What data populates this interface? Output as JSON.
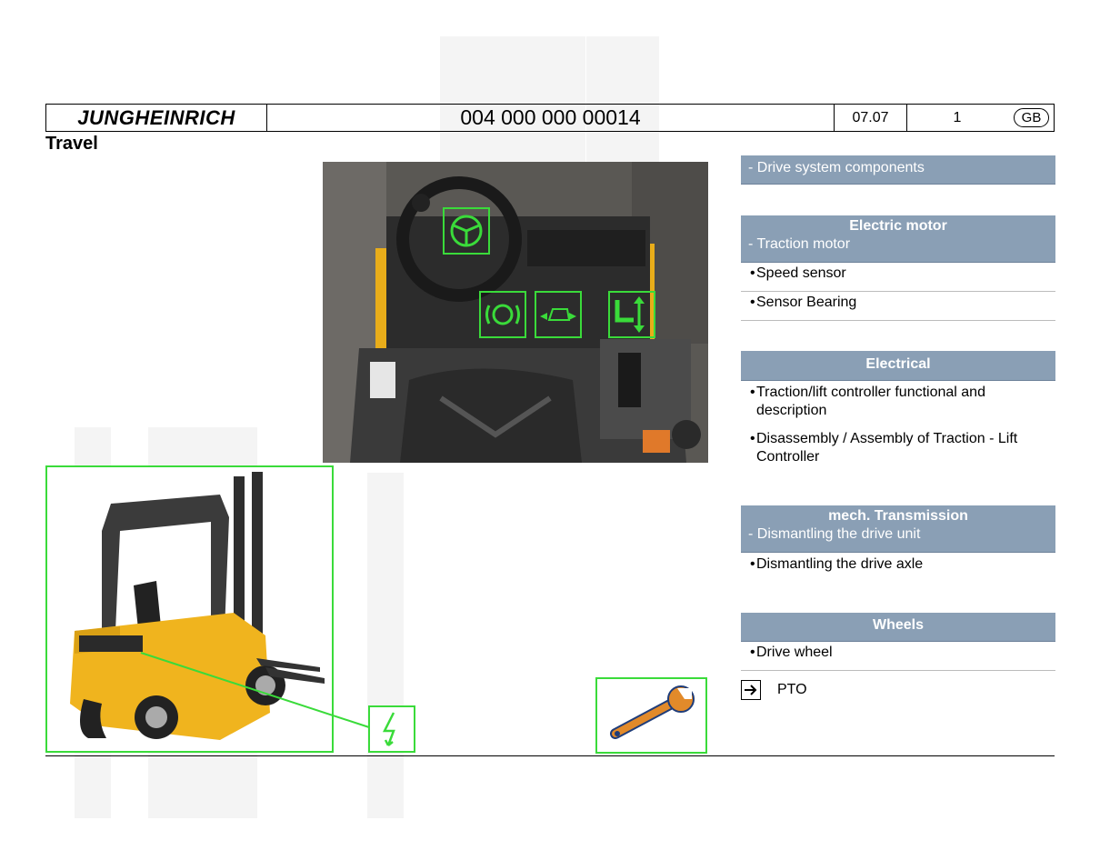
{
  "header": {
    "logo": "JUNGHEINRICH",
    "doc_number": "004 000 000 00014",
    "version": "07.07",
    "page": "1",
    "country": "GB"
  },
  "title": "Travel",
  "sections": [
    {
      "subtitle": "- Drive system components"
    },
    {
      "heading": "Electric motor",
      "subtitle": "- Traction motor",
      "items": [
        "Speed sensor",
        "Sensor Bearing"
      ]
    },
    {
      "heading": "Electrical",
      "items": [
        "Traction/lift controller functional and description",
        "Disassembly / Assembly of Traction - Lift Controller"
      ]
    },
    {
      "heading": "mech. Transmission",
      "subtitle": "- Dismantling the drive unit",
      "items": [
        "Dismantling the drive axle"
      ]
    },
    {
      "heading": "Wheels",
      "items": [
        "Drive wheel"
      ]
    }
  ],
  "pto_label": "PTO",
  "icons": {
    "steering": "steering-wheel-icon",
    "brake": "brake-icon",
    "drive": "drive-direction-icon",
    "lift": "lift-icon",
    "electric": "lightning-icon",
    "wrench": "wrench-icon",
    "arrow": "arrow-right-icon"
  },
  "colors": {
    "hotspot": "#3adb3a",
    "section_header": "#8a9fb5",
    "truck_yellow": "#f0b41e"
  }
}
